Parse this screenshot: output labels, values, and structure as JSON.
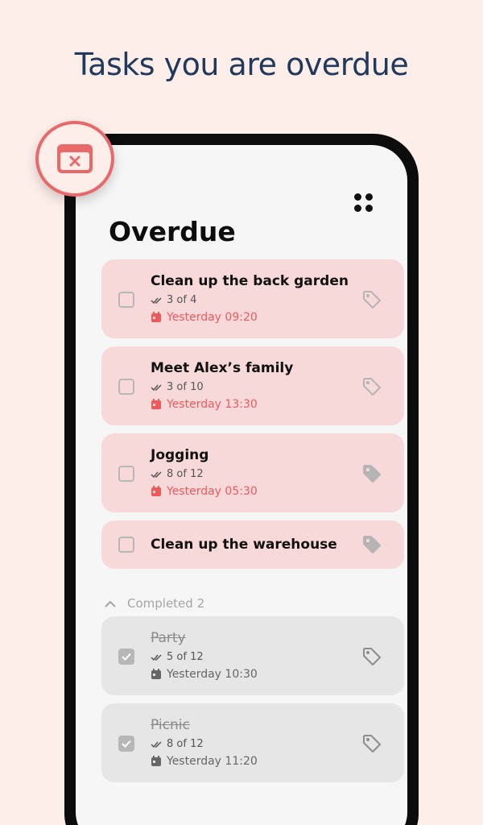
{
  "headline": "Tasks you are overdue",
  "page_title": "Overdue",
  "colors": {
    "accent": "#ee5a5c",
    "overdue_card": "#f8d9da",
    "done_card": "#e6e6e6",
    "headline": "#1f3a5c"
  },
  "overdue_tasks": [
    {
      "title": "Clean up the back garden",
      "progress": "3 of 4",
      "due": "Yesterday 09:20",
      "tag": "outline"
    },
    {
      "title": "Meet Alex’s family",
      "progress": "3 of 10",
      "due": "Yesterday 13:30",
      "tag": "outline"
    },
    {
      "title": "Jogging",
      "progress": "8 of 12",
      "due": "Yesterday 05:30",
      "tag": "filled"
    },
    {
      "title": "Clean up the warehouse",
      "tag": "filled"
    }
  ],
  "completed_section": {
    "label": "Completed 2",
    "icon": "chevron-up-icon"
  },
  "completed_tasks": [
    {
      "title": "Party",
      "progress": "5 of 12",
      "due": "Yesterday 10:30"
    },
    {
      "title": "Picnic",
      "progress": "8 of 12",
      "due": "Yesterday 11:20"
    }
  ]
}
